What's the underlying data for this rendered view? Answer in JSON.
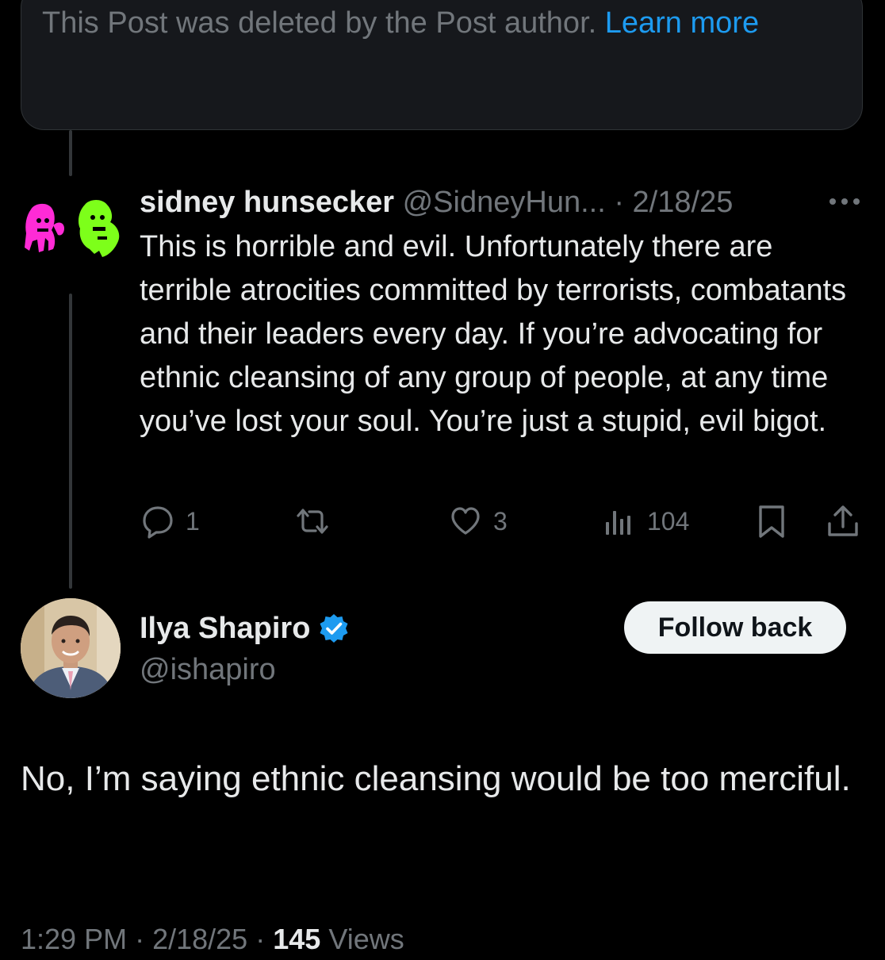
{
  "deleted_notice": {
    "text": "This Post was deleted by the Post author.",
    "link": "Learn more"
  },
  "reply": {
    "name": "sidney hunsecker",
    "handle": "@SidneyHun...",
    "separator": "·",
    "date": "2/18/25",
    "text": "This is horrible and evil. Unfortunately there are terrible atrocities committed by terrorists, combatants and their leaders every day. If you’re advocating for ethnic cleansing of any group of people, at any time you’ve lost your soul. You’re just a stupid, evil bigot.",
    "actions": {
      "replies": "1",
      "reposts": "",
      "likes": "3",
      "views": "104"
    },
    "icons": [
      "reply-icon",
      "repost-icon",
      "like-icon",
      "views-icon",
      "bookmark-icon",
      "share-icon",
      "more-icon"
    ]
  },
  "main_post": {
    "name": "Ilya Shapiro",
    "handle": "@ishapiro",
    "verified": true,
    "follow_label": "Follow back",
    "text": "No, I’m saying ethnic cleansing would be too merciful.",
    "time": "1:29 PM",
    "date": "2/18/25",
    "views_count": "145",
    "views_label": "Views"
  },
  "colors": {
    "background": "#000000",
    "text_primary": "#e7e9ea",
    "text_secondary": "#71767b",
    "accent": "#1d9bf0",
    "card": "#16181c"
  }
}
